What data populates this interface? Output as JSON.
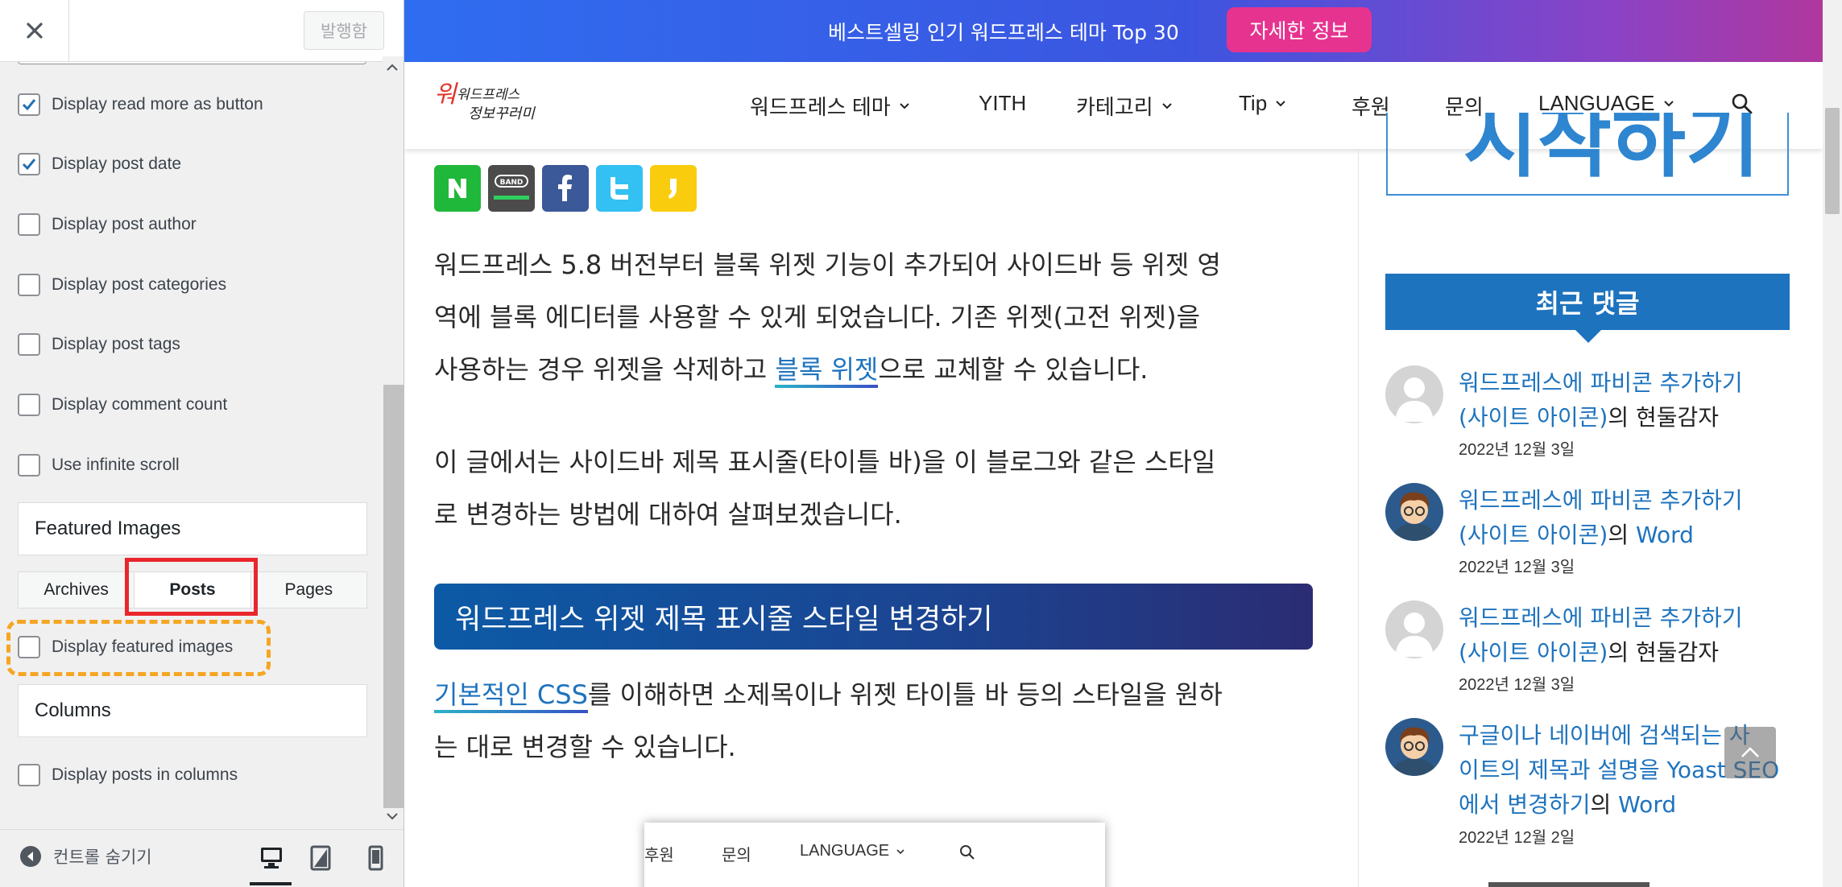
{
  "customizer": {
    "publish_label": "발행함",
    "options_top": [
      {
        "label": "Display read more as button",
        "checked": true
      },
      {
        "label": "Display post date",
        "checked": true
      },
      {
        "label": "Display post author",
        "checked": false
      },
      {
        "label": "Display post categories",
        "checked": false
      },
      {
        "label": "Display post tags",
        "checked": false
      },
      {
        "label": "Display comment count",
        "checked": false
      },
      {
        "label": "Use infinite scroll",
        "checked": false
      }
    ],
    "featured_images_heading": "Featured Images",
    "tabs": [
      {
        "label": "Archives",
        "active": false
      },
      {
        "label": "Posts",
        "active": true
      },
      {
        "label": "Pages",
        "active": false
      }
    ],
    "featured_option": {
      "label": "Display featured images",
      "checked": false
    },
    "columns_heading": "Columns",
    "columns_option": {
      "label": "Display posts in columns",
      "checked": false
    },
    "hide_controls_label": "컨트롤 숨기기",
    "highlight_colors": {
      "tab": "#e8262c",
      "option": "#f5a623"
    },
    "devices": [
      "desktop-icon",
      "tablet-icon",
      "mobile-icon"
    ]
  },
  "site": {
    "promo_text": "베스트셀링 인기 워드프레스 테마 Top 30",
    "promo_button": "자세한 정보",
    "logo_text": [
      "워드프레스",
      "정보꾸러미"
    ],
    "nav": [
      "워드프레스 테마",
      "YITH",
      "카테고리",
      "Tip",
      "후원",
      "문의",
      "LANGUAGE"
    ],
    "share_buttons": [
      "N",
      "BAND",
      "f",
      "twitter",
      ","
    ],
    "para1": "워드프레스 5.8 버전부터 블록 위젯 기능이 추가되어 사이드바 등 위젯 영",
    "para1_line2": "역에 블록 에디터를 사용할 수 있게 되었습니다. 기존 위젯(고전 위젯)을",
    "para1_line3_pre": "사용하는 경우 위젯을 삭제하고 ",
    "para1_link": "블록 위젯",
    "para1_line3_post": "으로 교체할 수 있습니다.",
    "para2_line1": "이 글에서는 사이드바 제목 표시줄(타이틀 바)을 이 블로그와 같은 스타일",
    "para2_line2": "로 변경하는 방법에 대하여 살펴보겠습니다.",
    "heading": "워드프레스 위젯 제목 표시줄 스타일 변경하기",
    "para3_link": "기본적인 CSS",
    "para3_line1_post": "를 이해하면 소제목이나 위젯 타이틀 바 등의 스타일을 원하",
    "para3_line2": "는 대로 변경할 수 있습니다.",
    "embedded_nav": [
      "후원",
      "문의",
      "LANGUAGE"
    ],
    "ad_text": "시작하기",
    "widget_title": "최근 댓글",
    "comments": [
      {
        "line1": "워드프레스에 파비콘 추가하기",
        "line2_link": "(사이트 아이콘)",
        "line2_rest": "의 현둘감자",
        "date": "2022년 12월 3일",
        "avatar": "default"
      },
      {
        "line1": "워드프레스에 파비콘 추가하기",
        "line2_link": "(사이트 아이콘)",
        "line2_rest": "의 ",
        "line2_author": "Word",
        "date": "2022년 12월 3일",
        "avatar": "cartoon"
      },
      {
        "line1": "워드프레스에 파비콘 추가하기",
        "line2_link": "(사이트 아이콘)",
        "line2_rest": "의 현둘감자",
        "date": "2022년 12월 3일",
        "avatar": "default"
      },
      {
        "line1": "구글이나 네이버에 검색되는 사",
        "line2_link": "이트의 제목과 설명을 Yoast SEO",
        "line3_link": "에서 변경하기",
        "line3_rest": "의 ",
        "line3_author": "Word",
        "date": "2022년 12월 2일",
        "avatar": "cartoon"
      }
    ],
    "colors": {
      "accent": "#1e73be",
      "promo_button": "#e6338f"
    }
  }
}
